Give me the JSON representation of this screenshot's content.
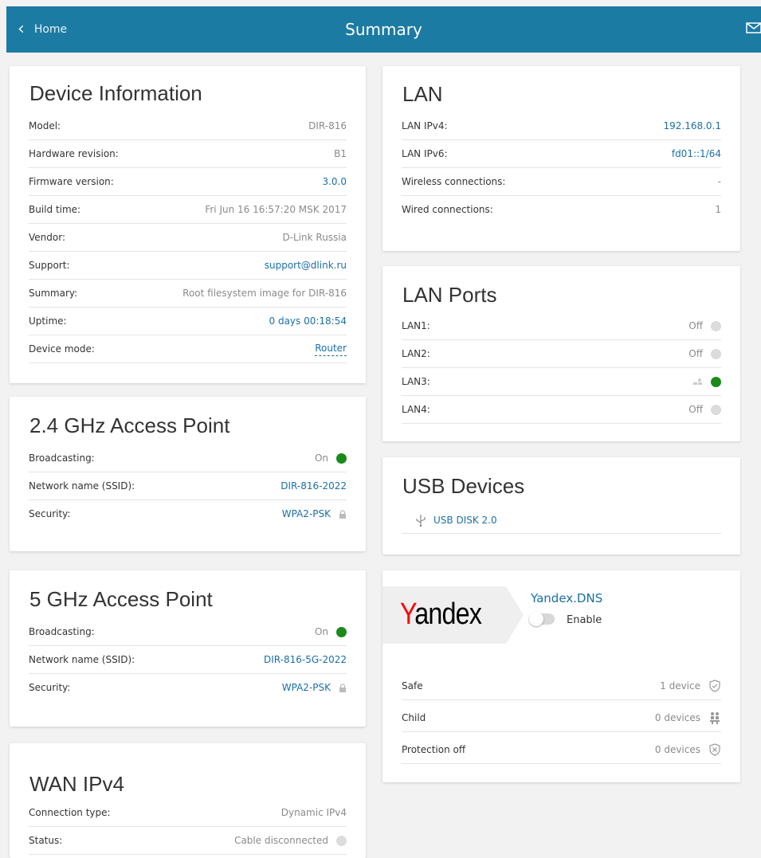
{
  "header": {
    "back_label": "Home",
    "title": "Summary",
    "mail_icon": "envelope-icon"
  },
  "device_info": {
    "title": "Device Information",
    "rows": [
      {
        "label": "Model:",
        "value": "DIR-816"
      },
      {
        "label": "Hardware revision:",
        "value": "B1"
      },
      {
        "label": "Firmware version:",
        "value": "3.0.0"
      },
      {
        "label": "Build time:",
        "value": "Fri Jun 16 16:57:20 MSK 2017"
      },
      {
        "label": "Vendor:",
        "value": "D-Link Russia"
      },
      {
        "label": "Support:",
        "value": "support@dlink.ru"
      },
      {
        "label": "Summary:",
        "value": "Root filesystem image for DIR-816"
      },
      {
        "label": "Uptime:",
        "value": "0 days 00:18:54"
      },
      {
        "label": "Device mode:",
        "value": "Router"
      }
    ]
  },
  "ap24": {
    "title": "2.4 GHz Access Point",
    "rows": [
      {
        "label": "Broadcasting:",
        "value": "On"
      },
      {
        "label": "Network name (SSID):",
        "value": "DIR-816-2022"
      },
      {
        "label": "Security:",
        "value": "WPA2-PSK"
      }
    ]
  },
  "ap5": {
    "title": "5 GHz Access Point",
    "rows": [
      {
        "label": "Broadcasting:",
        "value": "On"
      },
      {
        "label": "Network name (SSID):",
        "value": "DIR-816-5G-2022"
      },
      {
        "label": "Security:",
        "value": "WPA2-PSK"
      }
    ]
  },
  "wan": {
    "title": "WAN IPv4",
    "rows": [
      {
        "label": "Connection type:",
        "value": "Dynamic IPv4"
      },
      {
        "label": "Status:",
        "value": "Cable disconnected"
      }
    ]
  },
  "lan": {
    "title": "LAN",
    "rows": [
      {
        "label": "LAN IPv4:",
        "value": "192.168.0.1"
      },
      {
        "label": "LAN IPv6:",
        "value": "fd01::1/64"
      },
      {
        "label": "Wireless connections:",
        "value": "-"
      },
      {
        "label": "Wired connections:",
        "value": "1"
      }
    ]
  },
  "lan_ports": {
    "title": "LAN Ports",
    "rows": [
      {
        "label": "LAN1:",
        "value": "Off"
      },
      {
        "label": "LAN2:",
        "value": "Off"
      },
      {
        "label": "LAN3:",
        "value": ""
      },
      {
        "label": "LAN4:",
        "value": "Off"
      }
    ]
  },
  "usb": {
    "title": "USB Devices",
    "device": "USB DISK 2.0"
  },
  "yandex": {
    "logo_first": "Y",
    "logo_rest": "andex",
    "title": "Yandex.DNS",
    "enable_label": "Enable",
    "rows": [
      {
        "label": "Safe",
        "value": "1 device"
      },
      {
        "label": "Child",
        "value": "0 devices"
      },
      {
        "label": "Protection off",
        "value": "0 devices"
      }
    ]
  },
  "colors": {
    "header": "#1b7ba3",
    "link": "#1b6fa8",
    "status_on": "#1a8a1a",
    "status_off": "#dcdcdc"
  }
}
